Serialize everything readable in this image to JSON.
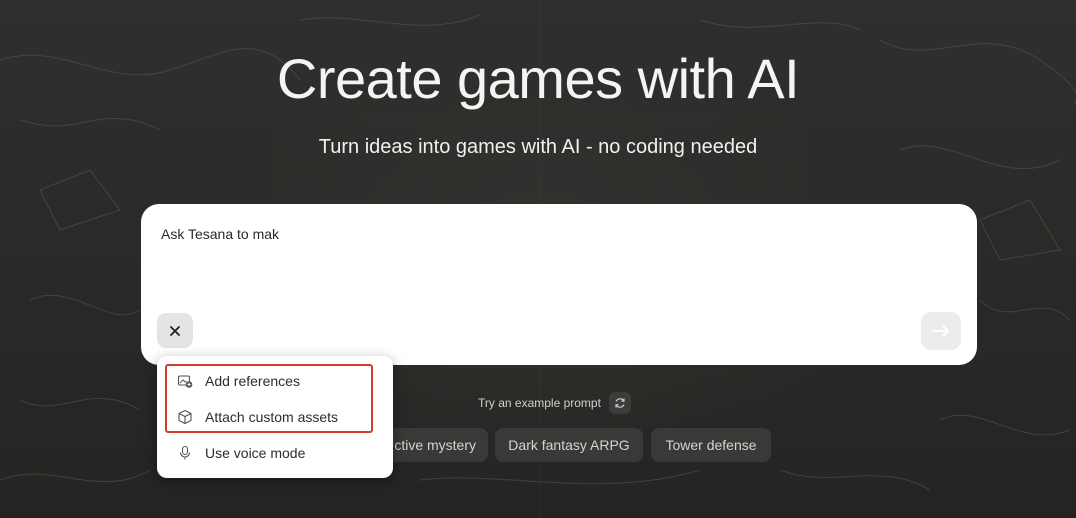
{
  "hero": {
    "title": "Create games with AI",
    "subtitle": "Turn ideas into games with AI - no coding needed"
  },
  "prompt": {
    "value": "Ask Tesana to mak",
    "close_icon": "close-icon",
    "submit_icon": "arrow-right-icon"
  },
  "menu": {
    "items": [
      {
        "label": "Add references",
        "icon": "image-add-icon"
      },
      {
        "label": "Attach custom assets",
        "icon": "cube-icon"
      },
      {
        "label": "Use voice mode",
        "icon": "microphone-icon"
      }
    ]
  },
  "examples": {
    "label": "Try an example prompt",
    "chips": [
      "ctive mystery",
      "Dark fantasy ARPG",
      "Tower defense"
    ]
  },
  "colors": {
    "highlight": "#d23d2d",
    "background": "#2b2a28"
  }
}
